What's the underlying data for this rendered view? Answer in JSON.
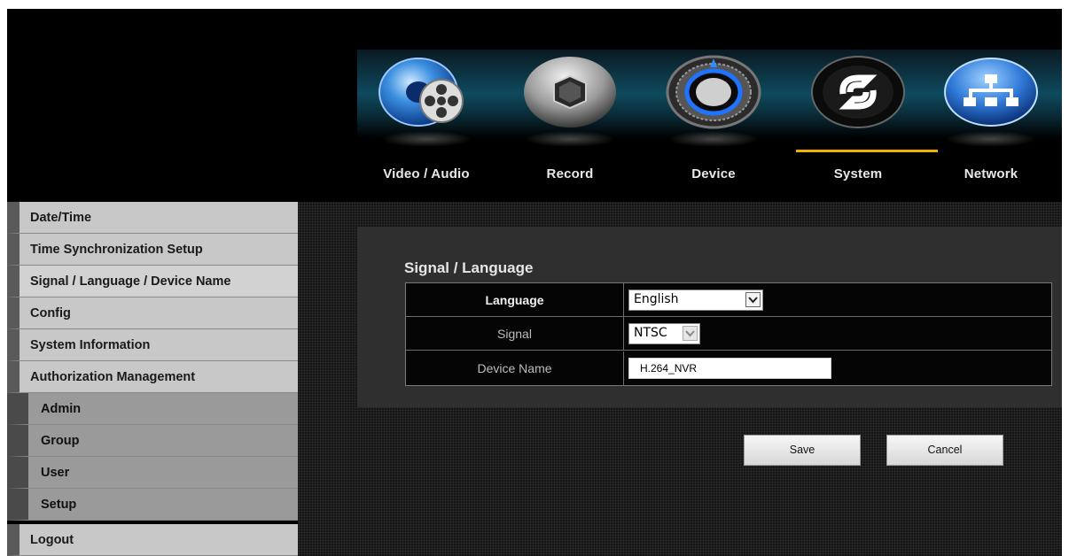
{
  "nav": {
    "items": [
      {
        "label": "Video / Audio",
        "icon": "video-audio-icon"
      },
      {
        "label": "Record",
        "icon": "record-icon"
      },
      {
        "label": "Device",
        "icon": "device-icon"
      },
      {
        "label": "System",
        "icon": "system-icon",
        "active": true
      },
      {
        "label": "Network",
        "icon": "network-icon"
      }
    ],
    "accent": "#f2b100"
  },
  "sidebar": {
    "items": [
      {
        "label": "Date/Time"
      },
      {
        "label": "Time Synchronization Setup"
      },
      {
        "label": "Signal / Language / Device Name",
        "active": true
      },
      {
        "label": "Config"
      },
      {
        "label": "System Information"
      },
      {
        "label": "Authorization Management"
      },
      {
        "label": "Admin",
        "sub": true
      },
      {
        "label": "Group",
        "sub": true
      },
      {
        "label": "User",
        "sub": true
      },
      {
        "label": "Setup",
        "sub": true
      },
      {
        "label": "Logout"
      }
    ]
  },
  "panel": {
    "title": "Signal / Language",
    "language": {
      "label": "Language",
      "value": "English"
    },
    "signal": {
      "label": "Signal",
      "value": "NTSC"
    },
    "device_name": {
      "label": "Device Name",
      "value": "H.264_NVR"
    }
  },
  "buttons": {
    "save": "Save",
    "cancel": "Cancel"
  }
}
